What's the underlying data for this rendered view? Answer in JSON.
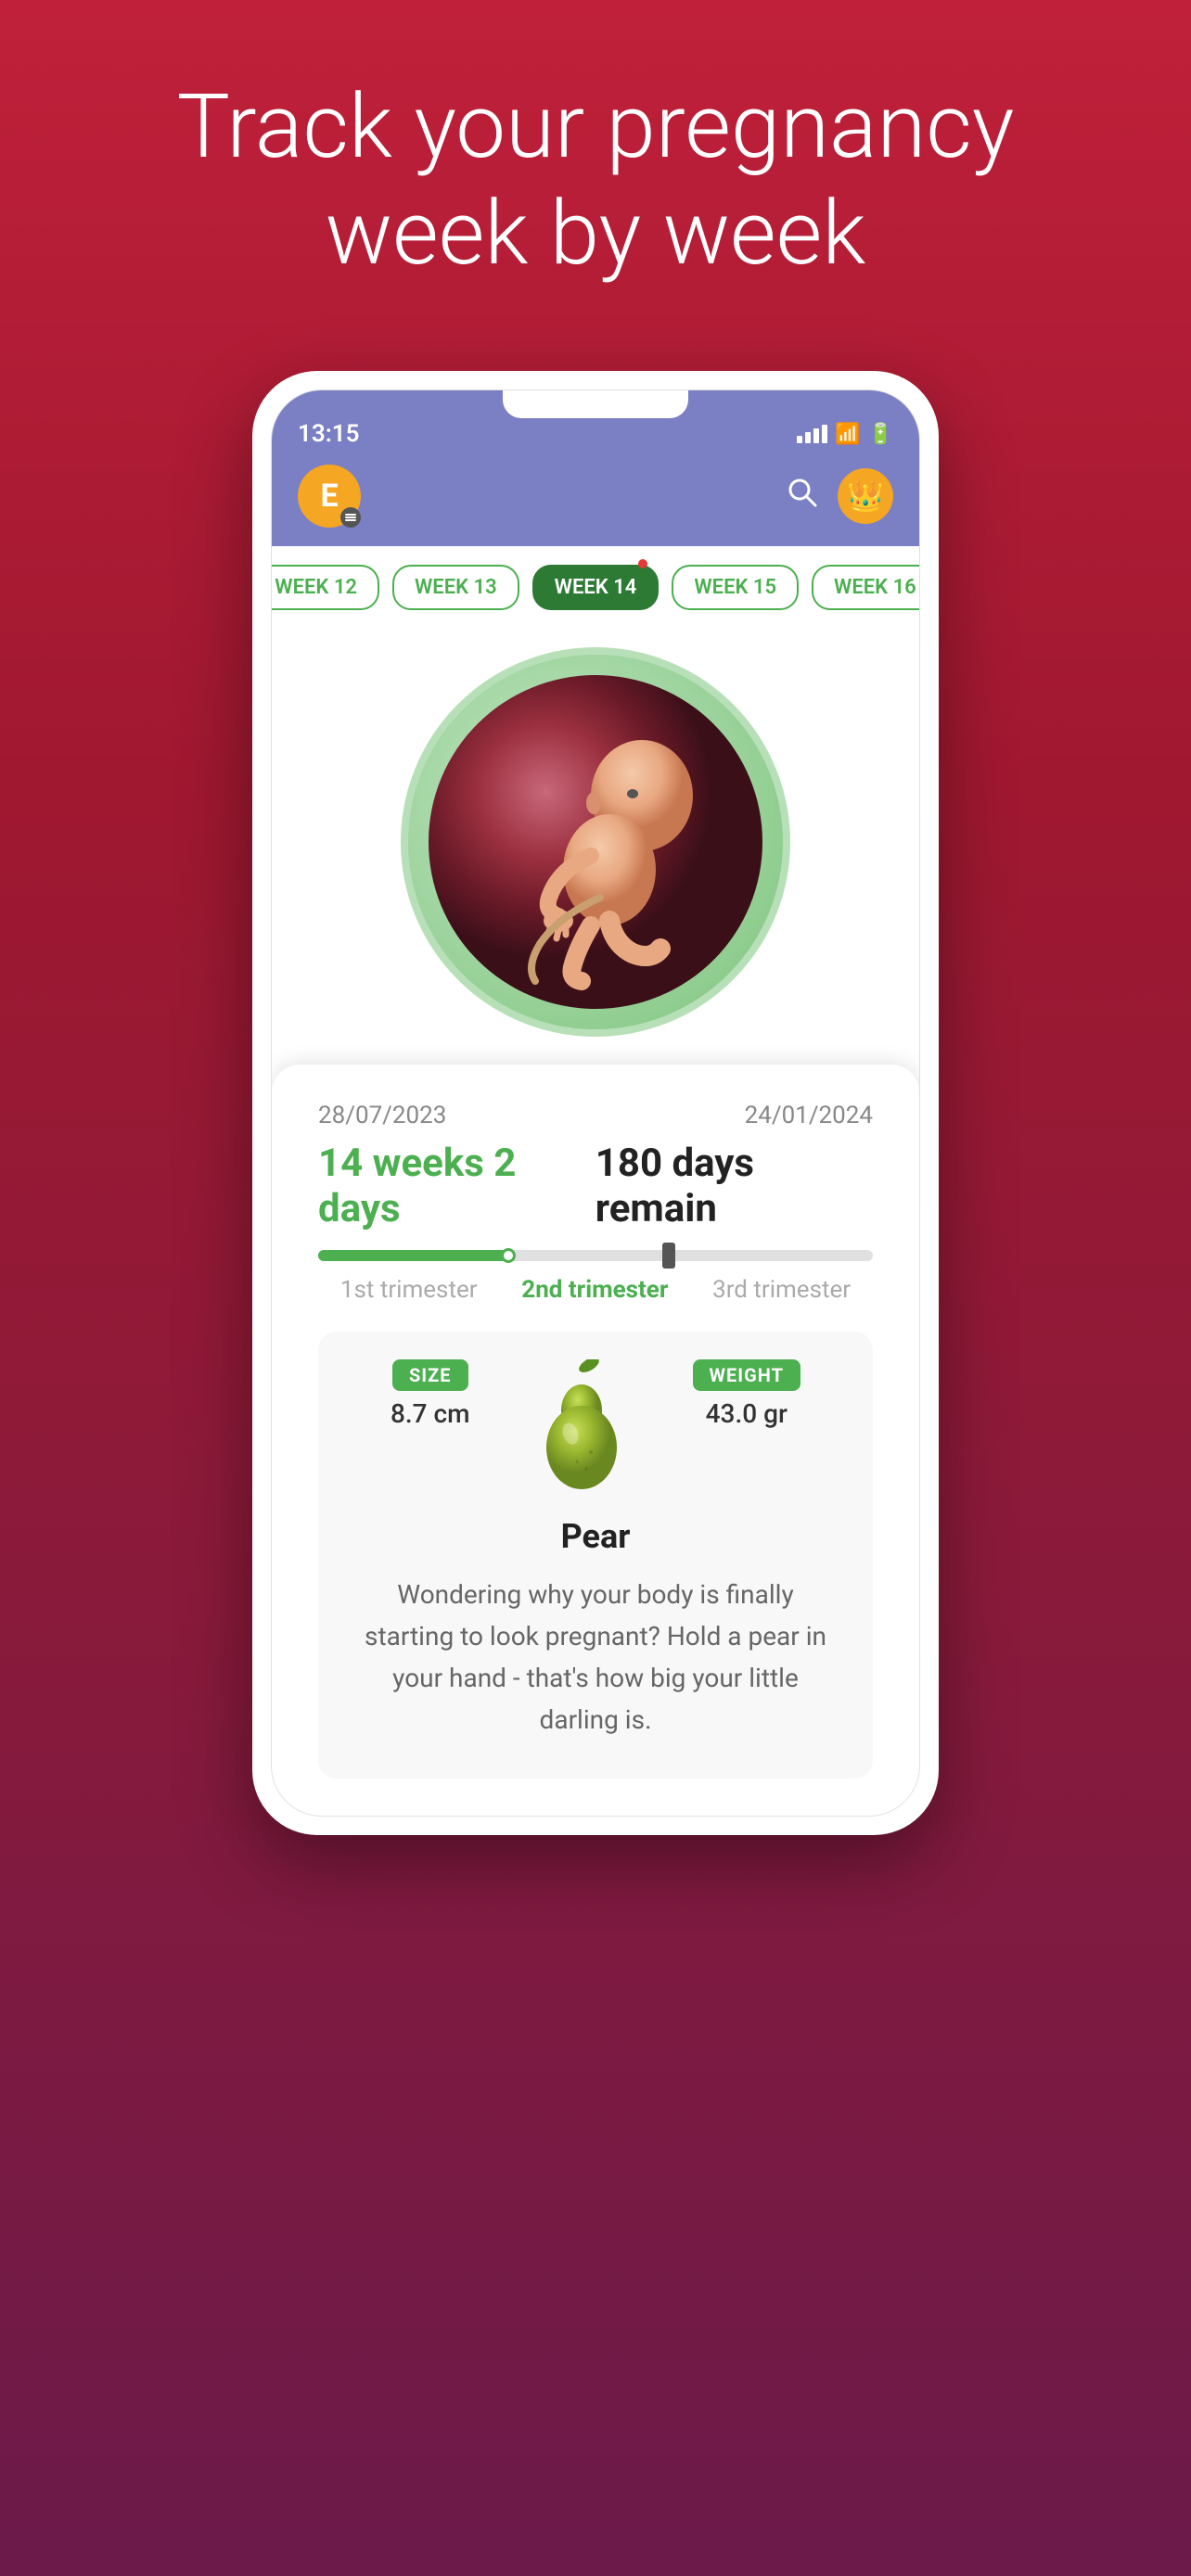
{
  "hero": {
    "title": "Track your pregnancy week by week"
  },
  "statusBar": {
    "time": "13:15",
    "signal": "signal",
    "wifi": "wifi",
    "battery": "battery"
  },
  "appHeader": {
    "avatarLetter": "E",
    "searchLabel": "search",
    "crownLabel": "premium"
  },
  "weekSelector": {
    "weeks": [
      {
        "label": "WEEK 12",
        "active": false
      },
      {
        "label": "WEEK 13",
        "active": false
      },
      {
        "label": "WEEK 14",
        "active": true
      },
      {
        "label": "WEEK 15",
        "active": false
      },
      {
        "label": "WEEK 16",
        "active": false
      }
    ]
  },
  "infoCard": {
    "startDate": "28/07/2023",
    "endDate": "24/01/2024",
    "weeksText": "14 weeks 2 days",
    "daysRemain": "180 days remain",
    "progressPercent": 35,
    "trimester1Label": "1st trimester",
    "trimester2Label": "2nd trimester",
    "trimester3Label": "3rd trimester"
  },
  "sizeCard": {
    "sizeLabel": "SIZE",
    "sizeValue": "8.7 cm",
    "weightLabel": "WEIGHT",
    "weightValue": "43.0 gr",
    "fruitName": "Pear",
    "description": "Wondering why your body is finally starting to look pregnant? Hold a pear in your hand - that's how big your little darling is."
  }
}
